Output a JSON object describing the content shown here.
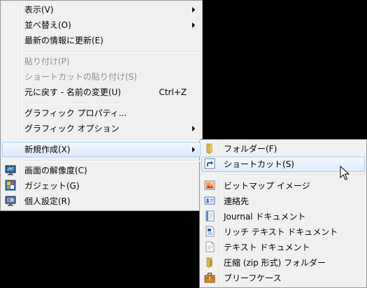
{
  "main_menu": {
    "items": [
      {
        "label": "表示(V)"
      },
      {
        "label": "並べ替え(O)"
      },
      {
        "label": "最新の情報に更新(E)"
      },
      {
        "label": "貼り付け(P)"
      },
      {
        "label": "ショートカットの貼り付け(S)"
      },
      {
        "label": "元に戻す - 名前の変更(U)",
        "shortcut": "Ctrl+Z"
      },
      {
        "label": "グラフィック プロパティ..."
      },
      {
        "label": "グラフィック オプション"
      },
      {
        "label": "新規作成(X)"
      },
      {
        "label": "画面の解像度(C)",
        "icon": "display-resolution-icon"
      },
      {
        "label": "ガジェット(G)",
        "icon": "gadgets-icon"
      },
      {
        "label": "個人設定(R)",
        "icon": "personalize-icon"
      }
    ]
  },
  "sub_menu": {
    "items": [
      {
        "label": "フォルダー(F)",
        "icon": "folder-icon"
      },
      {
        "label": "ショートカット(S)",
        "icon": "shortcut-icon"
      },
      {
        "label": "ビットマップ イメージ",
        "icon": "bitmap-image-icon"
      },
      {
        "label": "連絡先",
        "icon": "contact-icon"
      },
      {
        "label": "Journal ドキュメント",
        "icon": "journal-document-icon"
      },
      {
        "label": "リッチ テキスト ドキュメント",
        "icon": "rich-text-document-icon"
      },
      {
        "label": "テキスト ドキュメント",
        "icon": "text-document-icon"
      },
      {
        "label": "圧縮 (zip 形式) フォルダー",
        "icon": "zip-folder-icon"
      },
      {
        "label": "ブリーフケース",
        "icon": "briefcase-icon"
      }
    ]
  },
  "colors": {
    "background": "#000000",
    "menu_bg": "#f0f0f0",
    "highlight_border": "#aecff7",
    "disabled_text": "#8d8d8d"
  }
}
